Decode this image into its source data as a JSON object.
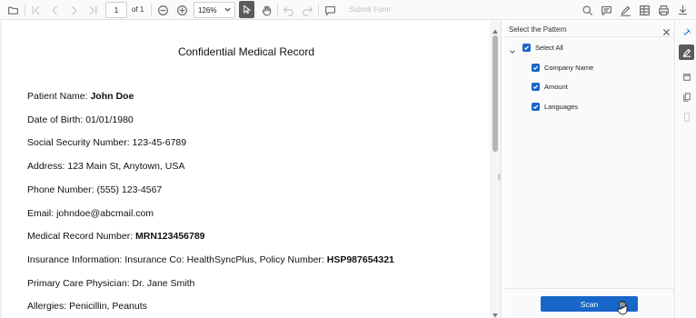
{
  "toolbar": {
    "page_number": "1",
    "page_count_label": "of 1",
    "zoom_level": "126%",
    "submit_form_label": "Submit Form"
  },
  "document": {
    "title": "Confidential Medical Record",
    "fields": [
      {
        "label": "Patient Name: ",
        "value": "John Doe",
        "bold": true
      },
      {
        "label": "Date of Birth: 01/01/1980",
        "value": "",
        "bold": false
      },
      {
        "label": "Social Security Number: 123-45-6789",
        "value": "",
        "bold": false
      },
      {
        "label": "Address: 123 Main St, Anytown, USA",
        "value": "",
        "bold": false
      },
      {
        "label": "Phone Number: (555) 123-4567",
        "value": "",
        "bold": false
      },
      {
        "label": "Email: johndoe@abcmail.com",
        "value": "",
        "bold": false
      },
      {
        "label": "Medical Record Number: ",
        "value": "MRN123456789",
        "bold": true
      },
      {
        "label": "Insurance Information: Insurance Co: HealthSyncPlus, Policy Number: ",
        "value": "HSP987654321",
        "bold": true
      },
      {
        "label": "Primary Care Physician: Dr. Jane Smith",
        "value": "",
        "bold": false
      },
      {
        "label": "Allergies: Penicillin, Peanuts",
        "value": "",
        "bold": false
      }
    ]
  },
  "pattern_panel": {
    "title": "Select the Pattern",
    "select_all_label": "Select All",
    "select_all_checked": true,
    "patterns": [
      {
        "label": "Company Name",
        "checked": true
      },
      {
        "label": "Amount",
        "checked": true
      },
      {
        "label": "Languages",
        "checked": true
      }
    ],
    "scan_label": "Scan"
  },
  "colors": {
    "accent": "#1766c8",
    "active_tool": "#5b5b5b"
  }
}
